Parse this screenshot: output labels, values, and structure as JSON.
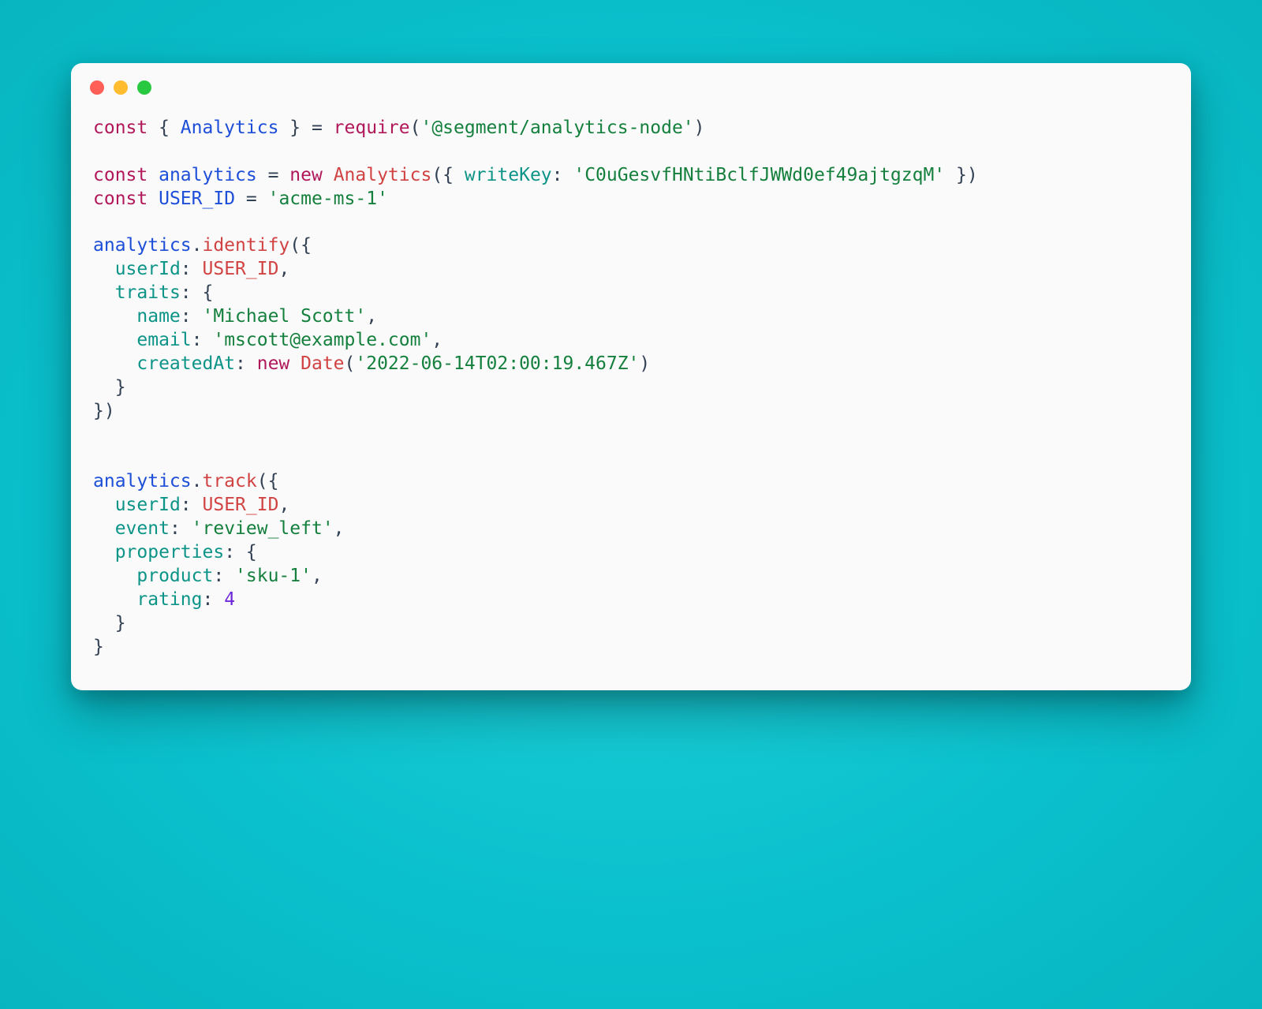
{
  "code": {
    "tokens": {
      "kw_const": "const",
      "kw_new": "new",
      "sym_Analytics": "Analytics",
      "sym_analytics": "analytics",
      "sym_require": "require",
      "sym_Date": "Date",
      "sym_USER_ID": "USER_ID",
      "call_identify": "identify",
      "call_track": "track",
      "prop_writeKey": "writeKey",
      "prop_userId": "userId",
      "prop_traits": "traits",
      "prop_name": "name",
      "prop_email": "email",
      "prop_createdAt": "createdAt",
      "prop_event": "event",
      "prop_properties": "properties",
      "prop_product": "product",
      "prop_rating": "rating",
      "str_pkg": "'@segment/analytics-node'",
      "str_writeKey": "'C0uGesvfHNtiBclfJWWd0ef49ajtgzqM'",
      "str_userid": "'acme-ms-1'",
      "str_name": "'Michael Scott'",
      "str_email": "'mscott@example.com'",
      "str_date": "'2022-06-14T02:00:19.467Z'",
      "str_event": "'review_left'",
      "str_product": "'sku-1'",
      "num_rating": "4"
    }
  }
}
